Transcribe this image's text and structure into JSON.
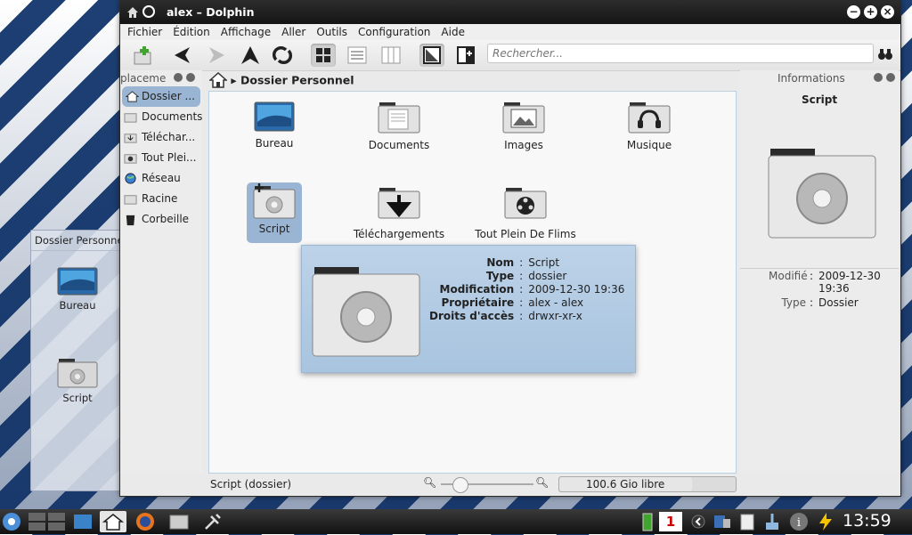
{
  "window": {
    "title": "alex – Dolphin"
  },
  "menu": [
    "Fichier",
    "Édition",
    "Affichage",
    "Aller",
    "Outils",
    "Configuration",
    "Aide"
  ],
  "toolbar": {
    "search_placeholder": "Rechercher..."
  },
  "places": {
    "header": "placeme",
    "items": [
      "Dossier ...",
      "Documents",
      "Téléchar...",
      "Tout Plei...",
      "Réseau",
      "Racine",
      "Corbeille"
    ]
  },
  "breadcrumb": "Dossier Personnel",
  "files": [
    "Bureau",
    "Documents",
    "Images",
    "Musique",
    "Script",
    "Téléchargements",
    "Tout Plein De Flims"
  ],
  "tooltip": {
    "rows": [
      {
        "key": "Nom",
        "value": "Script"
      },
      {
        "key": "Type",
        "value": "dossier"
      },
      {
        "key": "Modification",
        "value": "2009-12-30  19:36"
      },
      {
        "key": "Propriétaire",
        "value": "alex  -  alex"
      },
      {
        "key": "Droits  d'accès",
        "value": "drwxr-xr-x"
      }
    ]
  },
  "info": {
    "header": "Informations",
    "name": "Script",
    "modified_label": "Modifié",
    "modified_value": "2009-12-30 19:36",
    "type_label": "Type",
    "type_value": "Dossier"
  },
  "status": {
    "text": "Script (dossier)",
    "free_space": "100.6  Gio libre",
    "zoom_level": 0.2
  },
  "desktop": {
    "folderview_title": "Dossier Personnel",
    "items": [
      "Bureau",
      "Script"
    ]
  },
  "taskbar": {
    "clock": "13:59",
    "pager_active": "1"
  },
  "colors": {
    "selection": "#9ab5d3",
    "tooltip": "#b3cbe3",
    "titlebar": "#1c1c1c"
  }
}
